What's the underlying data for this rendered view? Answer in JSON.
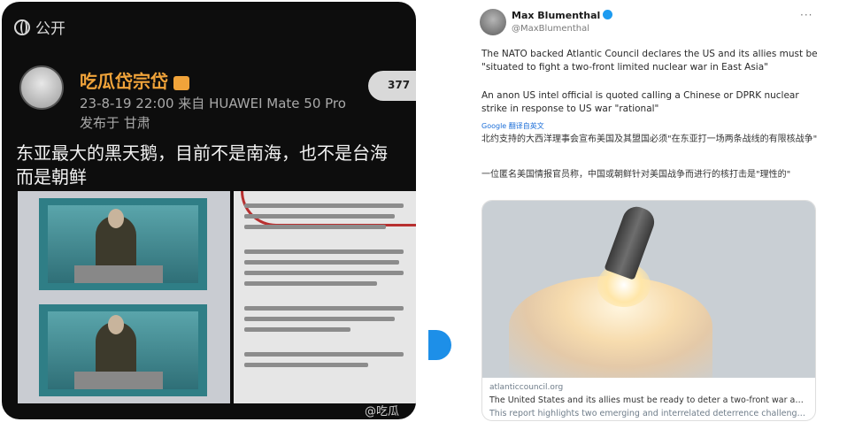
{
  "weibo": {
    "visibility": "公开",
    "username": "吃瓜岱宗岱",
    "meta": "23-8-19 22:00  来自 HUAWEI Mate 50 Pro",
    "location": "发布于 甘肃",
    "follow_button": "377",
    "text_line1": "东亚最大的黑天鹅，目前不是南海，也不是台海",
    "text_line2": "而是朝鲜",
    "watermark": "@吃瓜"
  },
  "tweet": {
    "author": "Max Blumenthal",
    "handle": "@MaxBlumenthal",
    "more": "···",
    "paragraph1": "The NATO backed Atlantic Council declares the US and its allies must be \"situated to fight a two-front limited nuclear war in East Asia\"",
    "paragraph2": "An anon US intel official is quoted calling a Chinese or DPRK nuclear strike in response to US war \"rational\"",
    "translate_label": "Google 翻译自英文",
    "zh_paragraph1": "北约支持的大西洋理事会宣布美国及其盟国必须\"在东亚打一场两条战线的有限核战争\"",
    "zh_paragraph2": "一位匿名美国情报官员称，中国或朝鲜针对美国战争而进行的核打击是\"理性的\"",
    "card": {
      "domain": "atlanticcouncil.org",
      "title": "The United States and its allies must be ready to deter a two-front war and n...",
      "description": "This report highlights two emerging and interrelated deterrence challenges in"
    }
  },
  "colors": {
    "weibo_bg": "#0d0d0d",
    "username": "#f0a33a",
    "arrow": "#1d8fe8",
    "verified": "#1d9bf0"
  }
}
